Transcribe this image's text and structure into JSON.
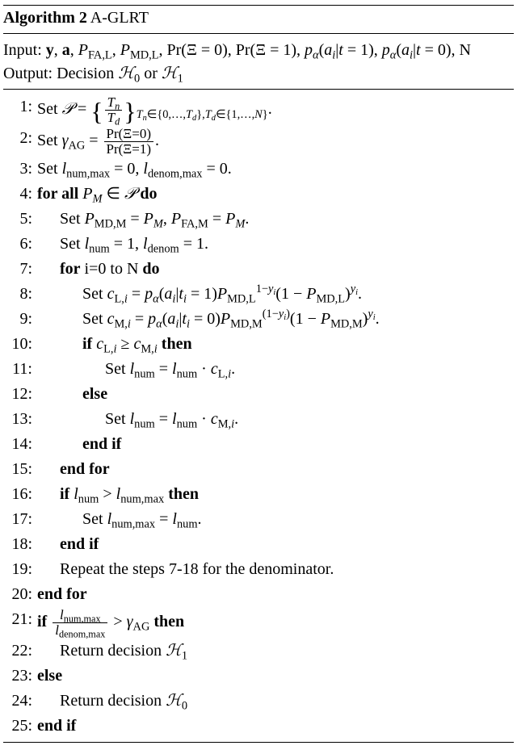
{
  "header": {
    "title_label": "Algorithm 2",
    "title_name": "A-GLRT",
    "input_label": "Input:",
    "inputs_html": "<span class='kw'>y</span>, <span class='kw'>a</span>, <span class='mi'>P</span><sub>FA,L</sub>, <span class='mi'>P</span><sub>MD,L</sub>, Pr(Ξ = 0), Pr(Ξ = 1), <span class='mi'>p</span><sub><span class='mi'>α</span></sub>(<span class='mi'>a<sub>i</sub></span>|<span class='mi'>t</span> = 1), <span class='mi'>p</span><sub><span class='mi'>α</span></sub>(<span class='mi'>a<sub>i</sub></span>|<span class='mi'>t</span> = 0), N",
    "output_label": "Output:",
    "outputs_html": "Decision <span class='cal'>ℋ</span><sub>0</sub> or <span class='cal'>ℋ</span><sub>1</sub>"
  },
  "lines": {
    "l1": "Set <span class='cal'>𝒫</span> = <span class='bigbrace'>{</span><span class='frac'><span class='num'><span class='mi'>T<sub>n</sub></span></span><span class='den'><span class='mi'>T<sub>d</sub></span></span></span><span class='bigbrace'>}</span><span class='subscript-block'><span class='mi'>T<sub>n</sub></span>∈{0,…,<span class='mi'>T<sub>d</sub></span>},<span class='mi'>T<sub>d</sub></span>∈{1,…,<span class='mi'>N</span>}</span>.",
    "l2": "Set <span class='mi'>γ</span><sub>AG</sub> = <span class='frac'><span class='num'>Pr(Ξ=0)</span><span class='den'>Pr(Ξ=1)</span></span>.",
    "l3": "Set <span class='mi'>l</span><sub>num,max</sub> = 0, <span class='mi'>l</span><sub>denom,max</sub> = 0.",
    "l4": "<span class='kw'>for all</span> <span class='mi'>P<sub>M</sub></span> ∈ <span class='cal'>𝒫</span> <span class='kw'>do</span>",
    "l5": "Set <span class='mi'>P</span><sub>MD,M</sub> = <span class='mi'>P<sub>M</sub></span>, <span class='mi'>P</span><sub>FA,M</sub> = <span class='mi'>P<sub>M</sub></span>.",
    "l6": "Set <span class='mi'>l</span><sub>num</sub> = 1, <span class='mi'>l</span><sub>denom</sub> = 1.",
    "l7": "<span class='kw'>for</span> i=0 to N <span class='kw'>do</span>",
    "l8": "Set <span class='mi'>c</span><sub>L,<span class='mi'>i</span></sub> = <span class='mi'>p</span><sub><span class='mi'>α</span></sub>(<span class='mi'>a<sub>i</sub></span>|<span class='mi'>t<sub>i</sub></span> = 1)<span class='mi'>P</span><sub>MD,L</sub><sup>1−<span class='mi'>y<sub>i</sub></span></sup>(1 − <span class='mi'>P</span><sub>MD,L</sub>)<sup><span class='mi'>y<sub>i</sub></span></sup>.",
    "l9": "Set <span class='mi'>c</span><sub>M,<span class='mi'>i</span></sub> = <span class='mi'>p</span><sub><span class='mi'>α</span></sub>(<span class='mi'>a<sub>i</sub></span>|<span class='mi'>t<sub>i</sub></span> = 0)<span class='mi'>P</span><sub>MD,M</sub><sup>(1−<span class='mi'>y<sub>i</sub></span>)</sup>(1 − <span class='mi'>P</span><sub>MD,M</sub>)<sup><span class='mi'>y<sub>i</sub></span></sup>.",
    "l10": "<span class='kw'>if</span> <span class='mi'>c</span><sub>L,<span class='mi'>i</span></sub> ≥ <span class='mi'>c</span><sub>M,<span class='mi'>i</span></sub> <span class='kw'>then</span>",
    "l11": "Set <span class='mi'>l</span><sub>num</sub> = <span class='mi'>l</span><sub>num</sub> · <span class='mi'>c</span><sub>L,<span class='mi'>i</span></sub>.",
    "l12": "<span class='kw'>else</span>",
    "l13": "Set <span class='mi'>l</span><sub>num</sub> = <span class='mi'>l</span><sub>num</sub> · <span class='mi'>c</span><sub>M,<span class='mi'>i</span></sub>.",
    "l14": "<span class='kw'>end if</span>",
    "l15": "<span class='kw'>end for</span>",
    "l16": "<span class='kw'>if</span> <span class='mi'>l</span><sub>num</sub> &gt; <span class='mi'>l</span><sub>num,max</sub> <span class='kw'>then</span>",
    "l17": "Set <span class='mi'>l</span><sub>num,max</sub> = <span class='mi'>l</span><sub>num</sub>.",
    "l18": "<span class='kw'>end if</span>",
    "l19": "Repeat the steps 7-18 for the denominator.",
    "l20": "<span class='kw'>end for</span>",
    "l21": "<span class='kw'>if</span> <span class='frac'><span class='num'><span class='mi'>l</span><sub>num,max</sub></span><span class='den'><span class='mi'>l</span><sub>denom,max</sub></span></span> &gt; <span class='mi'>γ</span><sub>AG</sub> <span class='kw'>then</span>",
    "l22": "Return decision <span class='cal'>ℋ</span><sub>1</sub>",
    "l23": "<span class='kw'>else</span>",
    "l24": "Return decision <span class='cal'>ℋ</span><sub>0</sub>",
    "l25": "<span class='kw'>end if</span>"
  },
  "nums": {
    "n1": "1:",
    "n2": "2:",
    "n3": "3:",
    "n4": "4:",
    "n5": "5:",
    "n6": "6:",
    "n7": "7:",
    "n8": "8:",
    "n9": "9:",
    "n10": "10:",
    "n11": "11:",
    "n12": "12:",
    "n13": "13:",
    "n14": "14:",
    "n15": "15:",
    "n16": "16:",
    "n17": "17:",
    "n18": "18:",
    "n19": "19:",
    "n20": "20:",
    "n21": "21:",
    "n22": "22:",
    "n23": "23:",
    "n24": "24:",
    "n25": "25:"
  }
}
